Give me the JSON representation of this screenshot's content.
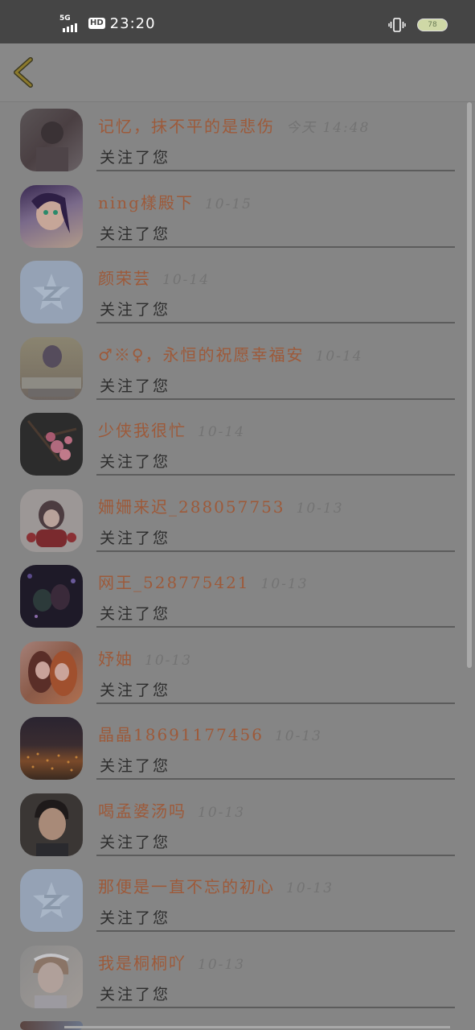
{
  "status_bar": {
    "network": "5G",
    "hd": "HD",
    "time": "23:20",
    "battery": "78"
  },
  "nav": {
    "back_icon": "chevron-left-icon"
  },
  "rows": [
    {
      "name": "记忆，抹不平的是悲伤",
      "time": "今天 14:48",
      "action": "关注了您",
      "avatar": "avatar-photo-dark"
    },
    {
      "name": "ning樣殿下",
      "time": "10-15",
      "action": "关注了您",
      "avatar": "avatar-anime-purple"
    },
    {
      "name": "颜荣芸",
      "time": "10-14",
      "action": "关注了您",
      "avatar": "avatar-default-qzone"
    },
    {
      "name": "♂※♀，永恒的祝愿幸福安",
      "time": "10-14",
      "action": "关注了您",
      "avatar": "avatar-photo-text"
    },
    {
      "name": "少侠我很忙",
      "time": "10-14",
      "action": "关注了您",
      "avatar": "avatar-blossom"
    },
    {
      "name": "姍姍来迟_288057753",
      "time": "10-13",
      "action": "关注了您",
      "avatar": "avatar-anime-doll"
    },
    {
      "name": "网王_528775421",
      "time": "10-13",
      "action": "关注了您",
      "avatar": "avatar-anime-dark"
    },
    {
      "name": "妤妯",
      "time": "10-13",
      "action": "关注了您",
      "avatar": "avatar-anime-girls"
    },
    {
      "name": "晶晶18691177456",
      "time": "10-13",
      "action": "关注了您",
      "avatar": "avatar-city-night"
    },
    {
      "name": "喝孟婆汤吗",
      "time": "10-13",
      "action": "关注了您",
      "avatar": "avatar-photo-man"
    },
    {
      "name": "那便是一直不忘的初心",
      "time": "10-13",
      "action": "关注了您",
      "avatar": "avatar-default-qzone"
    },
    {
      "name": "我是桐桐吖",
      "time": "10-13",
      "action": "关注了您",
      "avatar": "avatar-photo-girl"
    }
  ],
  "colors": {
    "overlay": "#858585",
    "name": "#9d5a3a",
    "status_bar": "#454545"
  }
}
